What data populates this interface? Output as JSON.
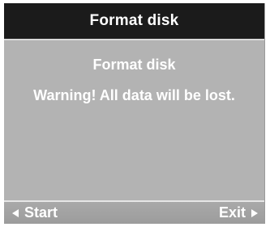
{
  "dialog": {
    "title": "Format disk",
    "message_title": "Format disk",
    "warning": "Warning! All data will be lost."
  },
  "softkeys": {
    "left_label": "Start",
    "left_icon": "arrow-left-icon",
    "right_label": "Exit",
    "right_icon": "arrow-right-icon"
  },
  "colors": {
    "title_bar": "#1b1b1b",
    "background": "#b5b5b5",
    "text": "#ffffff"
  }
}
